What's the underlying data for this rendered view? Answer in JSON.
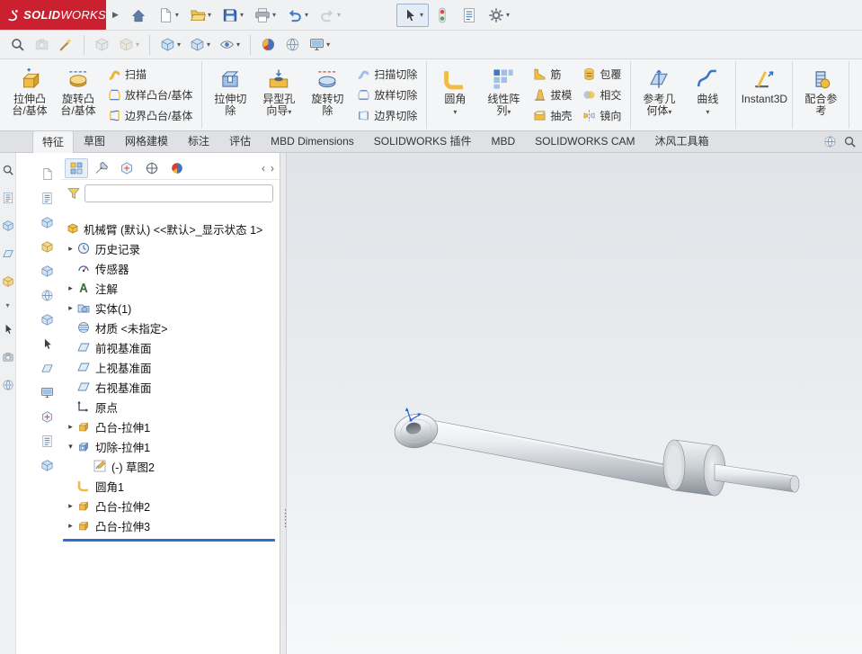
{
  "app": {
    "accent_red": "#cb2030",
    "selection_blue": "#2a6fd0"
  },
  "titlebar": {
    "brand_bold": "SOLID",
    "brand_light": "WORKS",
    "menu_arrow": "▶",
    "buttons": [
      {
        "name": "home",
        "icon": "home",
        "arrow": false
      },
      {
        "name": "new-document",
        "icon": "newdoc",
        "arrow": true
      },
      {
        "name": "open",
        "icon": "open",
        "arrow": true
      },
      {
        "name": "save",
        "icon": "save",
        "arrow": true
      },
      {
        "name": "print",
        "icon": "print",
        "arrow": true
      },
      {
        "name": "undo",
        "icon": "undo",
        "arrow": true
      },
      {
        "name": "redo",
        "icon": "redo",
        "arrow": true,
        "disabled": true
      },
      {
        "gap": true
      },
      {
        "name": "select",
        "icon": "cursor",
        "arrow": true,
        "pressed": true
      },
      {
        "name": "rebuild",
        "icon": "stoplight",
        "arrow": false
      },
      {
        "name": "file-properties",
        "icon": "sheet",
        "arrow": false
      },
      {
        "name": "options",
        "icon": "gear",
        "arrow": true
      }
    ]
  },
  "toolbar2": {
    "items": [
      {
        "name": "view-orientation",
        "icon": "mag",
        "arrow": false
      },
      {
        "name": "snapshot",
        "icon": "camera",
        "arrow": false,
        "disabled": true
      },
      {
        "name": "edit-appearance",
        "icon": "wand",
        "arrow": false
      },
      {
        "sep": true
      },
      {
        "name": "assembly-tool-1",
        "icon": "cube",
        "arrow": false,
        "disabled": true
      },
      {
        "name": "assembly-tool-2",
        "icon": "cubegold",
        "arrow": true,
        "disabled": true
      },
      {
        "sep": true
      },
      {
        "name": "section-view",
        "icon": "cube",
        "arrow": true
      },
      {
        "name": "display-style",
        "icon": "cube",
        "arrow": true
      },
      {
        "name": "hide-show-items",
        "icon": "eye",
        "arrow": true
      },
      {
        "sep": true
      },
      {
        "name": "apply-scene",
        "icon": "ball",
        "arrow": false
      },
      {
        "name": "realview",
        "icon": "ball2",
        "arrow": false
      },
      {
        "name": "view-settings",
        "icon": "monitor",
        "arrow": true
      }
    ]
  },
  "ribbon": {
    "groups": [
      {
        "name": "bosses",
        "items": [
          {
            "kind": "lg",
            "name": "extruded-boss",
            "icon": "extrude",
            "lines": [
              "拉伸凸",
              "台/基体"
            ],
            "arrow": false
          },
          {
            "kind": "lg",
            "name": "revolved-boss",
            "icon": "revolve",
            "lines": [
              "旋转凸",
              "台/基体"
            ],
            "arrow": false
          },
          {
            "kind": "col",
            "items": [
              {
                "name": "swept-boss",
                "icon": "sweep",
                "label": "扫描"
              },
              {
                "name": "lofted-boss",
                "icon": "loft",
                "label": "放样凸台/基体"
              },
              {
                "name": "boundary-boss",
                "icon": "boundary",
                "label": "边界凸台/基体"
              }
            ]
          }
        ]
      },
      {
        "name": "cuts",
        "items": [
          {
            "kind": "lg",
            "name": "extruded-cut",
            "icon": "cutex",
            "lines": [
              "拉伸切",
              "除"
            ],
            "arrow": false
          },
          {
            "kind": "lg",
            "name": "hole-wizard",
            "icon": "holewiz",
            "lines": [
              "异型孔",
              "向导"
            ],
            "arrow": true
          },
          {
            "kind": "lg",
            "name": "revolved-cut",
            "icon": "revcut",
            "lines": [
              "旋转切",
              "除"
            ],
            "arrow": false
          },
          {
            "kind": "col",
            "items": [
              {
                "name": "swept-cut",
                "icon": "sweepcut",
                "label": "扫描切除"
              },
              {
                "name": "lofted-cut",
                "icon": "loftcut",
                "label": "放样切除"
              },
              {
                "name": "boundary-cut",
                "icon": "boundcut",
                "label": "边界切除"
              }
            ]
          }
        ]
      },
      {
        "name": "features",
        "items": [
          {
            "kind": "lg",
            "name": "fillet",
            "icon": "fillet",
            "lines": [
              "圆角",
              ""
            ],
            "arrow": true
          },
          {
            "kind": "lg",
            "name": "linear-pattern",
            "icon": "pattern",
            "lines": [
              "线性阵",
              "列"
            ],
            "arrow": true
          },
          {
            "kind": "col",
            "items": [
              {
                "name": "rib",
                "icon": "rib",
                "label": "筋"
              },
              {
                "name": "draft",
                "icon": "draft",
                "label": "拔模"
              },
              {
                "name": "shell",
                "icon": "shell",
                "label": "抽壳"
              }
            ]
          },
          {
            "kind": "col",
            "items": [
              {
                "name": "wrap",
                "icon": "wrap",
                "label": "包覆"
              },
              {
                "name": "intersect",
                "icon": "intersect",
                "label": "相交"
              },
              {
                "name": "mirror",
                "icon": "mirror",
                "label": "镜向"
              }
            ]
          }
        ]
      },
      {
        "name": "reference",
        "items": [
          {
            "kind": "lg",
            "name": "reference-geometry",
            "icon": "refgeo",
            "lines": [
              "参考几",
              "何体"
            ],
            "arrow": true
          },
          {
            "kind": "lg",
            "name": "curves",
            "icon": "curve",
            "lines": [
              "曲线",
              ""
            ],
            "arrow": true
          }
        ]
      },
      {
        "name": "instant3d",
        "items": [
          {
            "kind": "lg",
            "name": "instant3d",
            "icon": "instant3d",
            "lines": [
              "Instant3D",
              ""
            ],
            "arrow": false
          }
        ]
      },
      {
        "name": "mate-reference",
        "items": [
          {
            "kind": "lg",
            "name": "mate-reference",
            "icon": "materef",
            "lines": [
              "配合参",
              "考"
            ],
            "arrow": false
          }
        ]
      }
    ]
  },
  "tabs": {
    "items": [
      {
        "name": "features",
        "label": "特征",
        "active": true
      },
      {
        "name": "sketch",
        "label": "草图",
        "active": false
      },
      {
        "name": "mesh-modeling",
        "label": "网格建模",
        "active": false
      },
      {
        "name": "annotation",
        "label": "标注",
        "active": false
      },
      {
        "name": "evaluate",
        "label": "评估",
        "active": false
      },
      {
        "name": "mbd-dimensions",
        "label": "MBD Dimensions",
        "active": false
      },
      {
        "name": "solidworks-addins",
        "label": "SOLIDWORKS 插件",
        "active": false
      },
      {
        "name": "mbd",
        "label": "MBD",
        "active": false
      },
      {
        "name": "solidworks-cam",
        "label": "SOLIDWORKS CAM",
        "active": false
      },
      {
        "name": "mufeng-toolbox",
        "label": "沐风工具箱",
        "active": false
      }
    ],
    "right_buttons": [
      {
        "name": "display-sphere",
        "icon": "ball2"
      },
      {
        "name": "command-search",
        "icon": "mag"
      }
    ]
  },
  "left_strip": {
    "items": [
      {
        "icon": "mag"
      },
      {
        "icon": "sheet"
      },
      {
        "icon": "cube"
      },
      {
        "icon": "plane"
      },
      {
        "icon": "cubegold"
      },
      {
        "arrow": true
      },
      {
        "icon": "cursor"
      },
      {
        "icon": "camera"
      },
      {
        "icon": "ball2"
      }
    ]
  },
  "side_toolbar": {
    "items": [
      {
        "icon": "newdoc"
      },
      {
        "icon": "sheet"
      },
      {
        "icon": "cube"
      },
      {
        "icon": "cubegold"
      },
      {
        "icon": "cube"
      },
      {
        "icon": "ball2"
      },
      {
        "icon": "cube"
      },
      {
        "icon": "cursor"
      },
      {
        "icon": "plane"
      },
      {
        "icon": "monitor"
      },
      {
        "icon": "configtab"
      },
      {
        "icon": "sheet"
      },
      {
        "icon": "cube"
      }
    ]
  },
  "panel": {
    "tabs": [
      {
        "name": "featuremanager",
        "icon": "feattab",
        "active": true
      },
      {
        "name": "propertymanager",
        "icon": "proptab",
        "active": false
      },
      {
        "name": "configurationmanager",
        "icon": "configtab",
        "active": false
      },
      {
        "name": "dimxpertmanager",
        "icon": "dimtab",
        "active": false
      },
      {
        "name": "displaymanager",
        "icon": "disptab",
        "active": false
      }
    ],
    "nav_prev": "‹",
    "nav_next": "›",
    "filter": {
      "value": "",
      "placeholder": ""
    },
    "tree": {
      "root": {
        "name": "part-root",
        "icon": "part",
        "label": "机械臂 (默认) <<默认>_显示状态 1>"
      },
      "items": [
        {
          "name": "history-folder",
          "icon": "history",
          "label": "历史记录",
          "arrow": "collapsed",
          "indent": 1
        },
        {
          "name": "sensors-folder",
          "icon": "sensor",
          "label": "传感器",
          "arrow": "none",
          "indent": 1
        },
        {
          "name": "annotations-folder",
          "icon": "anno",
          "label": "注解",
          "arrow": "collapsed",
          "indent": 1
        },
        {
          "name": "solid-bodies-folder",
          "icon": "solids",
          "label": "实体(1)",
          "arrow": "collapsed",
          "indent": 1
        },
        {
          "name": "material",
          "icon": "material",
          "label": "材质 <未指定>",
          "arrow": "none",
          "indent": 1
        },
        {
          "name": "front-plane",
          "icon": "plane",
          "label": "前视基准面",
          "arrow": "none",
          "indent": 1
        },
        {
          "name": "top-plane",
          "icon": "plane",
          "label": "上视基准面",
          "arrow": "none",
          "indent": 1
        },
        {
          "name": "right-plane",
          "icon": "plane",
          "label": "右视基准面",
          "arrow": "none",
          "indent": 1
        },
        {
          "name": "origin",
          "icon": "origin",
          "label": "原点",
          "arrow": "none",
          "indent": 1
        },
        {
          "name": "boss-extrude1",
          "icon": "boss",
          "label": "凸台-拉伸1",
          "arrow": "collapsed",
          "indent": 1
        },
        {
          "name": "cut-extrude1",
          "icon": "cuticon",
          "label": "切除-拉伸1",
          "arrow": "expanded",
          "indent": 1
        },
        {
          "name": "sketch2",
          "icon": "sketch",
          "label": "(-) 草图2",
          "arrow": "none",
          "indent": 2
        },
        {
          "name": "fillet1",
          "icon": "filletsm",
          "label": "圆角1",
          "arrow": "none",
          "indent": 1
        },
        {
          "name": "boss-extrude2",
          "icon": "boss",
          "label": "凸台-拉伸2",
          "arrow": "collapsed",
          "indent": 1
        },
        {
          "name": "boss-extrude3",
          "icon": "boss",
          "label": "凸台-拉伸3",
          "arrow": "collapsed",
          "indent": 1
        }
      ]
    }
  },
  "viewport": {
    "background_top": "#e0e3e7",
    "background_bottom": "#f6f8f9",
    "origin_marker_color": "#2a5bd7"
  }
}
